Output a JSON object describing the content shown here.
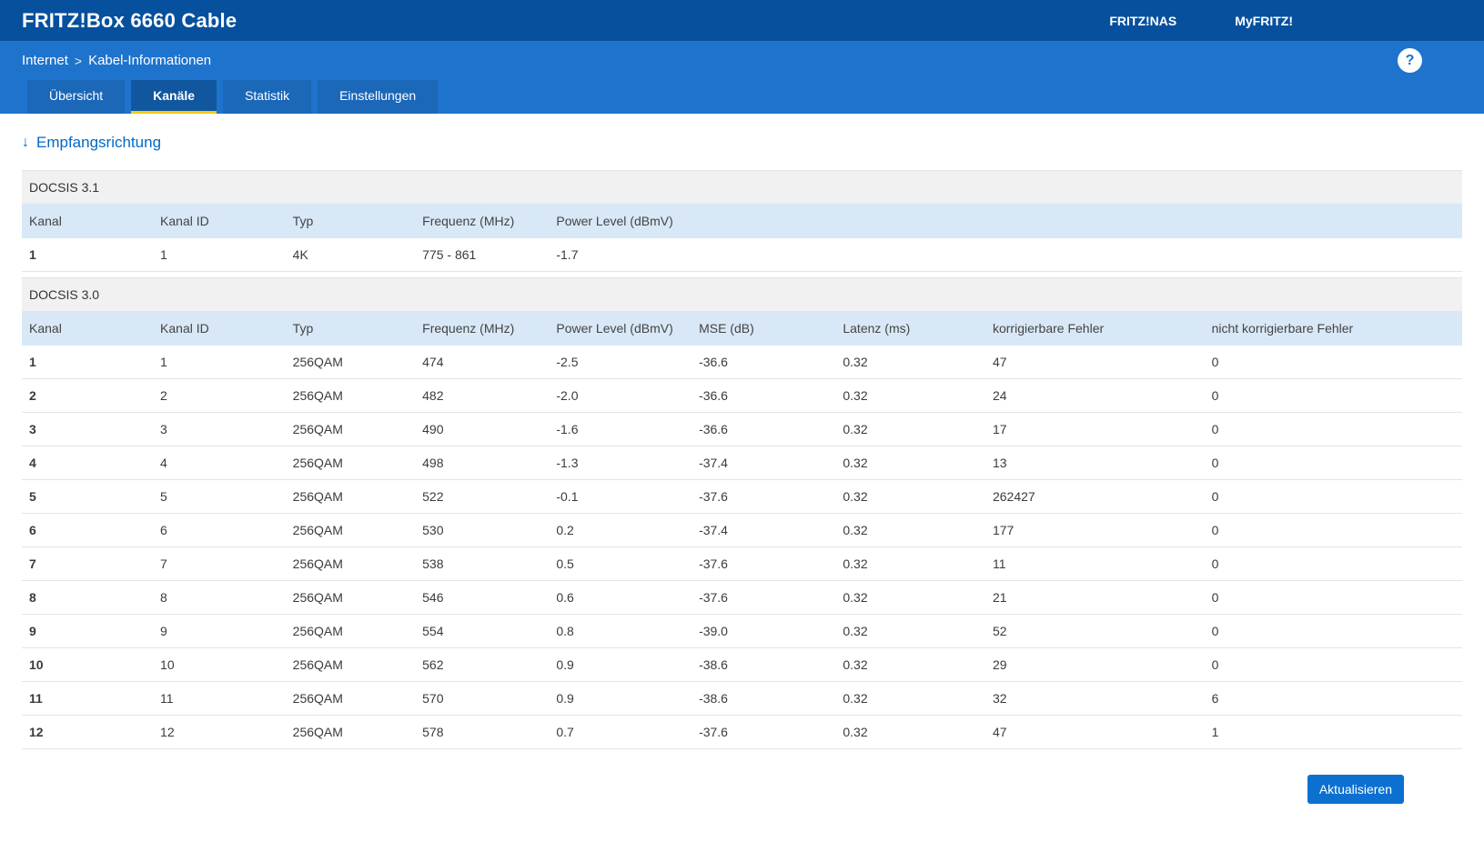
{
  "colors": {
    "header_bar": "#06509e",
    "nav_bar": "#1e73cd",
    "tab_bg": "#1b67b8",
    "tab_active_bg": "#11579f",
    "tab_underline": "#f6c915",
    "table_header_bg": "#d8e8f7",
    "section_row_bg": "#f1f1f1",
    "accent": "#0069c8",
    "button_bg": "#0c70d1",
    "text": "#3b3b3b",
    "border": "#e4e4e4"
  },
  "header": {
    "title": "FRITZ!Box 6660 Cable",
    "links": [
      {
        "label": "FRITZ!NAS"
      },
      {
        "label": "MyFRITZ!"
      }
    ]
  },
  "breadcrumb": {
    "section": "Internet",
    "separator": ">",
    "page": "Kabel-Informationen"
  },
  "help": {
    "glyph": "?"
  },
  "tabs": [
    {
      "name": "uebersicht",
      "label": "Übersicht",
      "active": false
    },
    {
      "name": "kanaele",
      "label": "Kanäle",
      "active": true
    },
    {
      "name": "statistik",
      "label": "Statistik",
      "active": false
    },
    {
      "name": "einstellungen",
      "label": "Einstellungen",
      "active": false
    }
  ],
  "content": {
    "section_arrow": "↓",
    "section_title": "Empfangsrichtung",
    "tables": [
      {
        "name": "docsis-31",
        "title": "DOCSIS 3.1",
        "headers": [
          "Kanal",
          "Kanal ID",
          "Typ",
          "Frequenz (MHz)",
          "Power Level (dBmV)"
        ],
        "rows": [
          [
            "1",
            "1",
            "4K",
            "775 - 861",
            "-1.7"
          ]
        ]
      },
      {
        "name": "docsis-30",
        "title": "DOCSIS 3.0",
        "headers": [
          "Kanal",
          "Kanal ID",
          "Typ",
          "Frequenz (MHz)",
          "Power Level (dBmV)",
          "MSE (dB)",
          "Latenz (ms)",
          "korrigierbare Fehler",
          "nicht korrigierbare Fehler"
        ],
        "rows": [
          [
            "1",
            "1",
            "256QAM",
            "474",
            "-2.5",
            "-36.6",
            "0.32",
            "47",
            "0"
          ],
          [
            "2",
            "2",
            "256QAM",
            "482",
            "-2.0",
            "-36.6",
            "0.32",
            "24",
            "0"
          ],
          [
            "3",
            "3",
            "256QAM",
            "490",
            "-1.6",
            "-36.6",
            "0.32",
            "17",
            "0"
          ],
          [
            "4",
            "4",
            "256QAM",
            "498",
            "-1.3",
            "-37.4",
            "0.32",
            "13",
            "0"
          ],
          [
            "5",
            "5",
            "256QAM",
            "522",
            "-0.1",
            "-37.6",
            "0.32",
            "262427",
            "0"
          ],
          [
            "6",
            "6",
            "256QAM",
            "530",
            "0.2",
            "-37.4",
            "0.32",
            "177",
            "0"
          ],
          [
            "7",
            "7",
            "256QAM",
            "538",
            "0.5",
            "-37.6",
            "0.32",
            "11",
            "0"
          ],
          [
            "8",
            "8",
            "256QAM",
            "546",
            "0.6",
            "-37.6",
            "0.32",
            "21",
            "0"
          ],
          [
            "9",
            "9",
            "256QAM",
            "554",
            "0.8",
            "-39.0",
            "0.32",
            "52",
            "0"
          ],
          [
            "10",
            "10",
            "256QAM",
            "562",
            "0.9",
            "-38.6",
            "0.32",
            "29",
            "0"
          ],
          [
            "11",
            "11",
            "256QAM",
            "570",
            "0.9",
            "-38.6",
            "0.32",
            "32",
            "6"
          ],
          [
            "12",
            "12",
            "256QAM",
            "578",
            "0.7",
            "-37.6",
            "0.32",
            "47",
            "1"
          ]
        ]
      }
    ]
  },
  "footer": {
    "refresh_label": "Aktualisieren"
  }
}
